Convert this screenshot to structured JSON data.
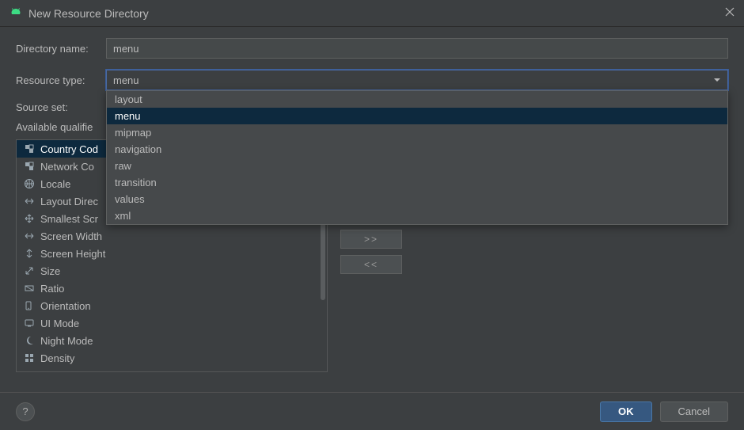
{
  "window": {
    "title": "New Resource Directory"
  },
  "form": {
    "directory_name_label": "Directory name:",
    "directory_name_value": "menu",
    "resource_type_label": "Resource type:",
    "resource_type_value": "menu",
    "source_set_label": "Source set:"
  },
  "resource_type_options": [
    {
      "label": "layout"
    },
    {
      "label": "menu",
      "selected": true
    },
    {
      "label": "mipmap"
    },
    {
      "label": "navigation"
    },
    {
      "label": "raw"
    },
    {
      "label": "transition"
    },
    {
      "label": "values"
    },
    {
      "label": "xml"
    }
  ],
  "available": {
    "heading": "Available qualifie",
    "items": [
      {
        "icon": "country-code",
        "label": "Country Cod",
        "selected": true
      },
      {
        "icon": "network-code",
        "label": "Network Co"
      },
      {
        "icon": "globe",
        "label": "Locale"
      },
      {
        "icon": "layout-dir",
        "label": "Layout Direc"
      },
      {
        "icon": "smallest",
        "label": "Smallest Scr"
      },
      {
        "icon": "width",
        "label": "Screen Width"
      },
      {
        "icon": "height",
        "label": "Screen Height"
      },
      {
        "icon": "size",
        "label": "Size"
      },
      {
        "icon": "ratio",
        "label": "Ratio"
      },
      {
        "icon": "orientation",
        "label": "Orientation"
      },
      {
        "icon": "uimode",
        "label": "UI Mode"
      },
      {
        "icon": "nightmode",
        "label": "Night Mode"
      },
      {
        "icon": "density",
        "label": "Density"
      }
    ]
  },
  "move": {
    "add": ">>",
    "remove": "<<"
  },
  "footer": {
    "help": "?",
    "ok": "OK",
    "cancel": "Cancel"
  }
}
